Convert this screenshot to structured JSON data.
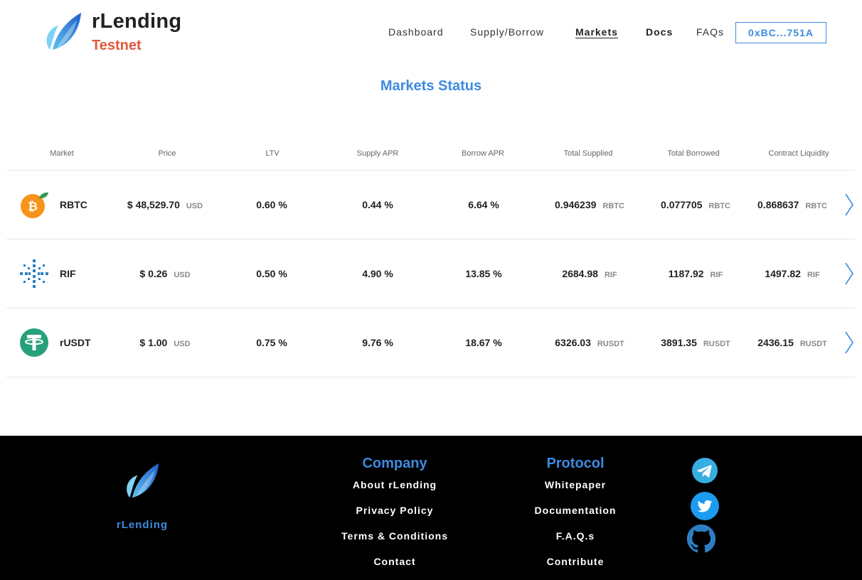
{
  "header": {
    "brand": "rLending",
    "network": "Testnet",
    "nav": [
      "Dashboard",
      "Supply/Borrow",
      "Markets",
      "Docs",
      "FAQs"
    ],
    "wallet": "0xBC...751A"
  },
  "main": {
    "title": "Markets Status",
    "columns": [
      "Market",
      "Price",
      "LTV",
      "Supply APR",
      "Borrow APR",
      "Total Supplied",
      "Total Borrowed",
      "Contract Liquidity"
    ],
    "rows": [
      {
        "name": "RBTC",
        "icon": "rbtc-icon",
        "price": "$ 48,529.70",
        "price_unit": "USD",
        "ltv": "0.60 %",
        "supply_apr": "0.44 %",
        "borrow_apr": "6.64 %",
        "supplied": "0.946239",
        "supplied_unit": "RBTC",
        "borrowed": "0.077705",
        "borrowed_unit": "RBTC",
        "liquidity": "0.868637",
        "liquidity_unit": "RBTC"
      },
      {
        "name": "RIF",
        "icon": "rif-icon",
        "price": "$ 0.26",
        "price_unit": "USD",
        "ltv": "0.50 %",
        "supply_apr": "4.90 %",
        "borrow_apr": "13.85 %",
        "supplied": "2684.98",
        "supplied_unit": "RIF",
        "borrowed": "1187.92",
        "borrowed_unit": "RIF",
        "liquidity": "1497.82",
        "liquidity_unit": "RIF"
      },
      {
        "name": "rUSDT",
        "icon": "tether-icon",
        "price": "$ 1.00",
        "price_unit": "USD",
        "ltv": "0.75 %",
        "supply_apr": "9.76 %",
        "borrow_apr": "18.67 %",
        "supplied": "6326.03",
        "supplied_unit": "RUSDT",
        "borrowed": "3891.35",
        "borrowed_unit": "RUSDT",
        "liquidity": "2436.15",
        "liquidity_unit": "RUSDT"
      }
    ]
  },
  "footer": {
    "brand": "rLending",
    "company": {
      "title": "Company",
      "links": [
        "About rLending",
        "Privacy Policy",
        "Terms & Conditions",
        "Contact"
      ]
    },
    "protocol": {
      "title": "Protocol",
      "links": [
        "Whitepaper",
        "Documentation",
        "F.A.Q.s",
        "Contribute"
      ]
    },
    "social": [
      "telegram-icon",
      "twitter-icon",
      "github-icon"
    ]
  },
  "colors": {
    "accent": "#3d8be0",
    "network": "#e05a3a",
    "rbtc": "#f7931a",
    "rif": "#2d7ec4",
    "tether": "#26a17b"
  }
}
